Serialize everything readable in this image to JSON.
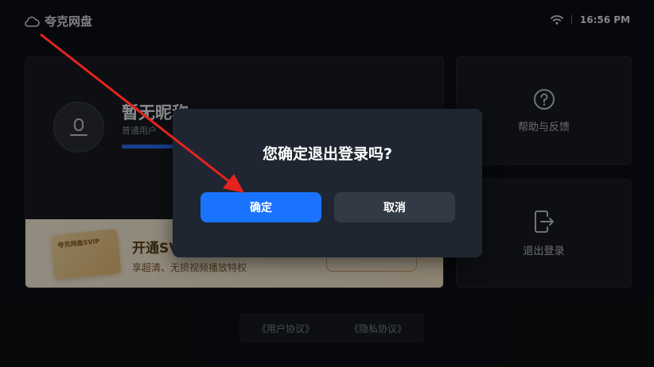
{
  "app": {
    "name": "夸克网盘",
    "logo_icon": "cloud-icon"
  },
  "status": {
    "time": "16:56 PM",
    "wifi_icon": "wifi-icon"
  },
  "profile": {
    "nickname": "暂无昵称",
    "user_type": "普通用户",
    "storage_fraction": 0.34,
    "promo": {
      "card_text": "夸克网盘SVIP",
      "title": "开通SV",
      "subtitle": "享超清、无损视频播放特权"
    }
  },
  "side": {
    "help_label": "帮助与反馈",
    "logout_label": "退出登录"
  },
  "agreements": {
    "user": "《用户协议》",
    "privacy": "《隐私协议》"
  },
  "dialog": {
    "title": "您确定退出登录吗?",
    "confirm": "确定",
    "cancel": "取消"
  },
  "colors": {
    "primary": "#1a73ff",
    "background": "#0d0f13",
    "annotation_arrow": "#e8231f"
  }
}
